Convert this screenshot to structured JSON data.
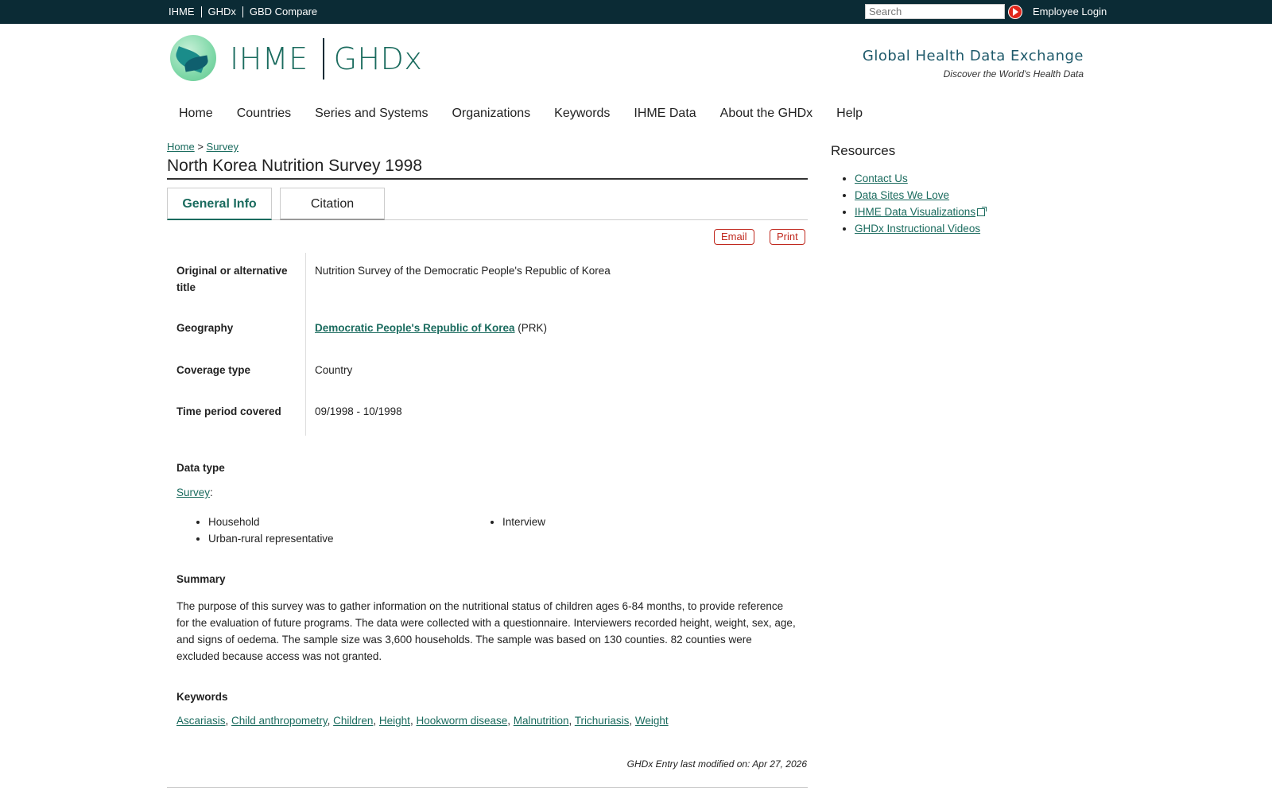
{
  "topbar": {
    "links": [
      "IHME",
      "GHDx",
      "GBD Compare"
    ],
    "search_placeholder": "Search",
    "login": "Employee Login"
  },
  "header": {
    "brand_left": "IHME",
    "brand_right": "GHDx",
    "tagline_title": "Global Health Data Exchange",
    "tagline_sub": "Discover the World's Health Data"
  },
  "nav": {
    "items": [
      "Home",
      "Countries",
      "Series and Systems",
      "Organizations",
      "Keywords",
      "IHME Data",
      "About the GHDx",
      "Help"
    ]
  },
  "breadcrumb": {
    "home": "Home",
    "sep": ">",
    "current": "Survey"
  },
  "page": {
    "title": "North Korea Nutrition Survey 1998",
    "tabs": [
      "General Info",
      "Citation"
    ],
    "email_label": "Email",
    "print_label": "Print"
  },
  "info": {
    "alt_title_label": "Original or alternative title",
    "alt_title_value": "Nutrition Survey of the Democratic People's Republic of Korea",
    "geography_label": "Geography",
    "geography_link": "Democratic People's Republic of Korea",
    "geography_code": "(PRK)",
    "coverage_label": "Coverage type",
    "coverage_value": "Country",
    "time_label": "Time period covered",
    "time_value": "09/1998 - 10/1998"
  },
  "datatype": {
    "heading": "Data type",
    "link": "Survey",
    "colon": ":",
    "items_col1": [
      "Household",
      "Urban-rural representative"
    ],
    "items_col2": [
      "Interview"
    ]
  },
  "summary": {
    "heading": "Summary",
    "text": "The purpose of this survey was to gather information on the nutritional status of children ages 6-84 months, to provide reference for the evaluation of future programs. The data were collected with a questionnaire. Interviewers recorded height, weight, sex, age, and signs of oedema. The sample size was 3,600 households. The sample was based on 130 counties. 82 counties were excluded because access was not granted."
  },
  "keywords": {
    "heading": "Keywords",
    "items": [
      "Ascariasis",
      "Child anthropometry",
      "Children",
      "Height",
      "Hookworm disease",
      "Malnutrition",
      "Trichuriasis",
      "Weight"
    ]
  },
  "footer": {
    "modified": "GHDx Entry last modified on: Apr 27, 2026"
  },
  "sidebar": {
    "title": "Resources",
    "items": [
      "Contact Us",
      "Data Sites We Love",
      "IHME Data Visualizations",
      "GHDx Instructional Videos"
    ]
  }
}
